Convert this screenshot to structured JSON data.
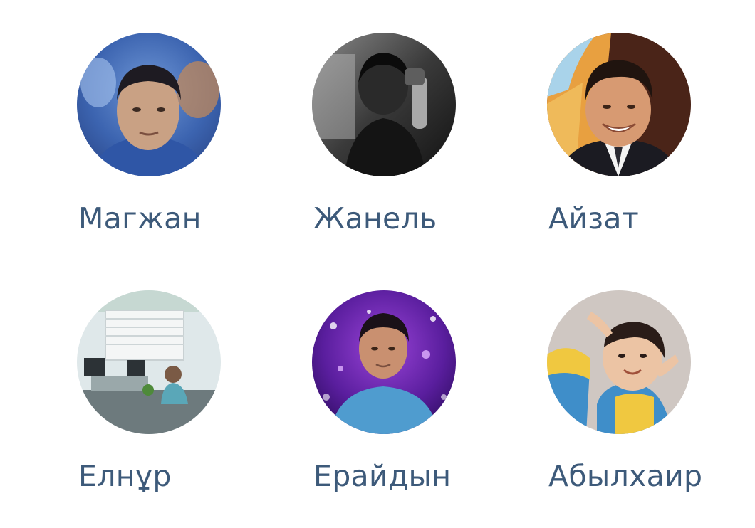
{
  "friends": [
    {
      "name": "Магжан",
      "avatar_icon": "person-photo-icon"
    },
    {
      "name": "Жанель",
      "avatar_icon": "person-photo-icon"
    },
    {
      "name": "Айзат",
      "avatar_icon": "person-photo-icon"
    },
    {
      "name": "Елнұр",
      "avatar_icon": "person-photo-icon"
    },
    {
      "name": "Ерайдын",
      "avatar_icon": "person-photo-icon"
    },
    {
      "name": "Абылхаир",
      "avatar_icon": "person-photo-icon"
    }
  ],
  "colors": {
    "name_text": "#3d5a7a",
    "background": "#ffffff"
  }
}
